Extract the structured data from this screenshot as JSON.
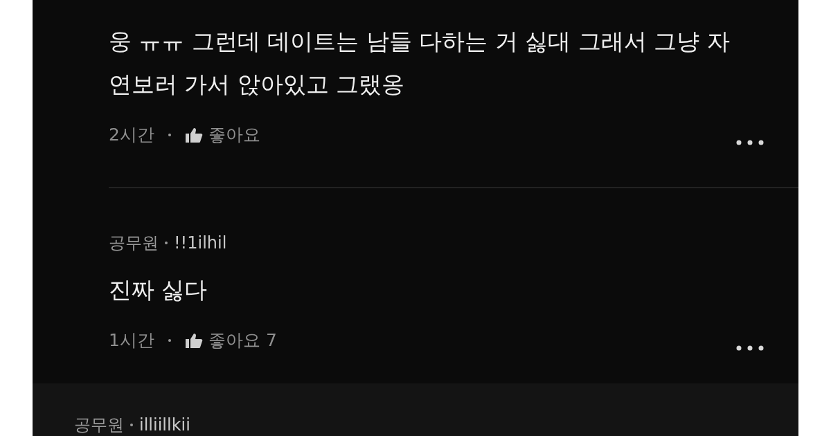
{
  "replies": [
    {
      "text": "웅 ㅠㅠ 그런데 데이트는 남들 다하는 거 싫대 그래서 그냥 자연보러 가서 앉아있고 그랬옹",
      "time": "2시간",
      "like_label": "좋아요"
    },
    {
      "author": "공무원",
      "nickname": "!!1ilhil",
      "text": "진짜 싫다",
      "time": "1시간",
      "like_label": "좋아요",
      "like_count": "7"
    }
  ],
  "next_comment": {
    "author": "공무원",
    "nickname": "illiillkii"
  }
}
